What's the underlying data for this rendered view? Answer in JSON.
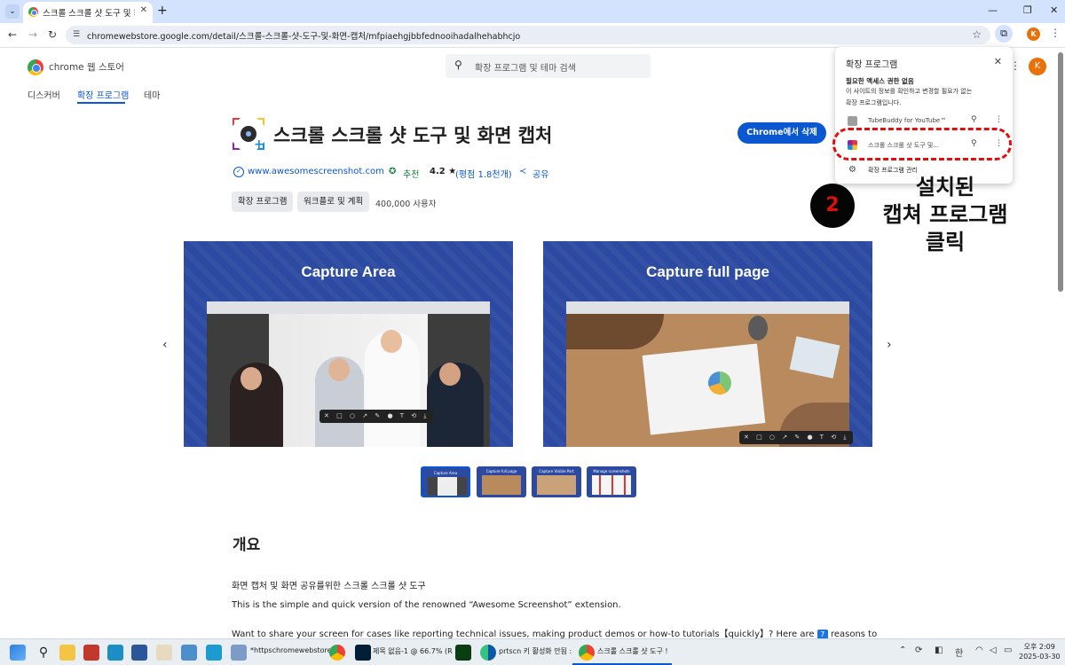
{
  "browser": {
    "tab_title": "스크롤 스크롤 샷 도구 및 화면",
    "url": "chromewebstore.google.com/detail/스크롤-스크롤-샷-도구-및-화면-캡처/mfpiaehgjbbfednooihadalhehabhcjo",
    "avatar_initial": "K",
    "accent_color": "#0b57d0"
  },
  "store": {
    "name": "chrome 웹 스토어",
    "search_placeholder": "확장 프로그램 및 테마 검색",
    "nav_tabs": [
      "디스커버",
      "확장 프로그램",
      "테마"
    ],
    "active_tab": "확장 프로그램",
    "avatar_initial": "K"
  },
  "extension": {
    "title": "스크롤 스크롤 샷 도구 및 화면 캡처",
    "remove_button": "Chrome에서 삭제",
    "website": "www.awesomescreenshot.com",
    "recommended": "추천",
    "rating": "4.2 ★",
    "rating_count": "(평점 1.8천개)",
    "share": "공유",
    "chips": [
      "확장 프로그램",
      "워크플로 및 계획"
    ],
    "users": "400,000 사용자",
    "slides": [
      {
        "title": "Capture Area"
      },
      {
        "title": "Capture full page"
      }
    ],
    "thumbnails": [
      "Capture Area",
      "Capture full page",
      "Capture Visible Part",
      "Manage screenshots"
    ],
    "overview_title": "개요",
    "desc_line1": "화면 캡처 및 화면 공유를위한 스크롤 스크롤 샷 도구",
    "desc_line2": "This is the simple and quick version of the renowned “Awesome Screenshot” extension.",
    "desc_line3_a": "Want to share your screen for cases like reporting technical issues, making product demos or how-to tutorials【quickly】?  Here are",
    "desc_line3_badge": "7",
    "desc_line3_b": "reasons to"
  },
  "popup": {
    "title": "확장 프로그램",
    "subtitle": "필요한 액세스 권한 없음",
    "text_line1": "이 사이트의 정보를 확인하고 변경할 필요가 없는",
    "text_line2": "확장 프로그램입니다.",
    "items": [
      {
        "label": "TubeBuddy for YouTube™"
      },
      {
        "label": "스크롤 스크롤 샷 도구 및..."
      }
    ],
    "manage": "확장 프로그램 관리"
  },
  "annotation": {
    "step_number": "2",
    "line1": "설치된",
    "line2": "캡쳐 프로그램",
    "line3": "클릭",
    "highlight_color": "#e10e0e"
  },
  "taskbar": {
    "items": [
      {
        "label": "*httpschromewebstore.."
      },
      {
        "label": "제목 없음-1 @ 66.7% (R"
      },
      {
        "label": "prtscn 키 활성화 안됨 :"
      },
      {
        "label": "스크롤 스크롤 샷 도구 !"
      }
    ],
    "ime": "한",
    "clock_time": "오후 2:09",
    "clock_date": "2025-03-30"
  }
}
